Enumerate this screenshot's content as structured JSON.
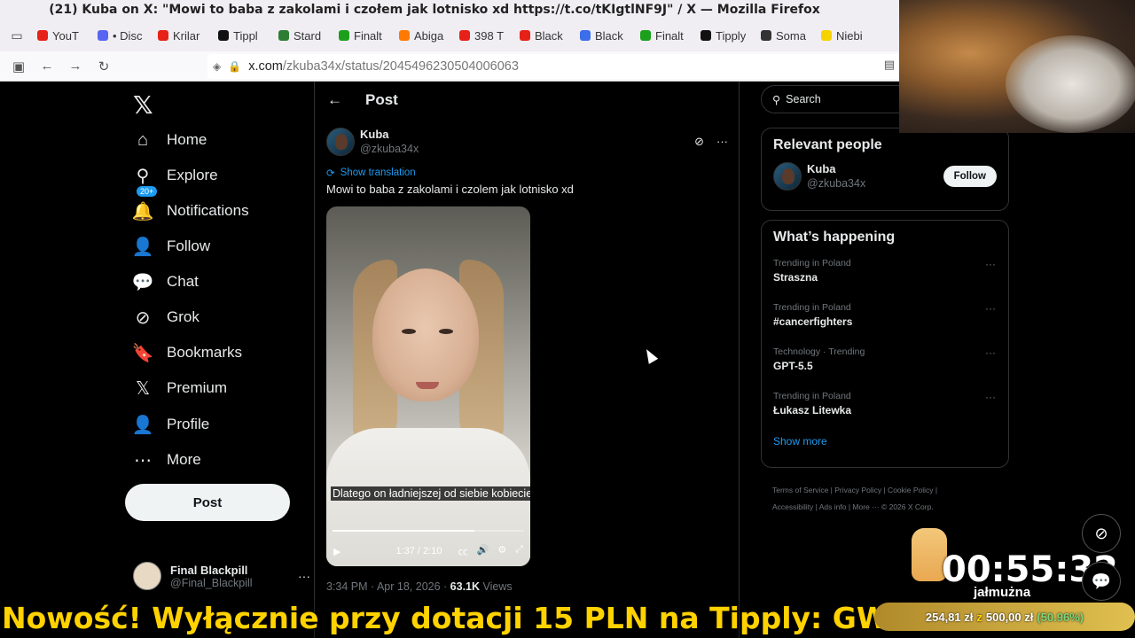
{
  "window": {
    "title": "(21) Kuba on X: \"Mowi to baba z zakolami i czołem jak lotnisko xd https://t.co/tKIgtlNF9J\" / X — Mozilla Firefox"
  },
  "tabs": [
    {
      "label": "YouT",
      "color": "#e62117"
    },
    {
      "label": "• Disc",
      "color": "#5865f2"
    },
    {
      "label": "Krilar",
      "color": "#e62117"
    },
    {
      "label": "Tippl",
      "color": "#111111"
    },
    {
      "label": "Stard",
      "color": "#2e7d32"
    },
    {
      "label": "Finalt",
      "color": "#1ca01c"
    },
    {
      "label": "Abiga",
      "color": "#ff7a00"
    },
    {
      "label": "398 T",
      "color": "#e62117"
    },
    {
      "label": "Black",
      "color": "#e62117"
    },
    {
      "label": "Black",
      "color": "#3b6ee8"
    },
    {
      "label": "Finalt",
      "color": "#1ca01c"
    },
    {
      "label": "Tipply",
      "color": "#111111"
    },
    {
      "label": "Soma",
      "color": "#333333"
    },
    {
      "label": "Niebi",
      "color": "#f5d200"
    }
  ],
  "url": {
    "host": "x.com",
    "path": "/zkuba34x/status/2045496230504006063"
  },
  "nav": {
    "items": [
      {
        "label": "Home",
        "icon": "⌂"
      },
      {
        "label": "Explore",
        "icon": "⚲"
      },
      {
        "label": "Notifications",
        "icon": "🔔"
      },
      {
        "label": "Follow",
        "icon": "👤"
      },
      {
        "label": "Chat",
        "icon": "💬"
      },
      {
        "label": "Grok",
        "icon": "⊘"
      },
      {
        "label": "Bookmarks",
        "icon": "🔖"
      },
      {
        "label": "Premium",
        "icon": "𝕏"
      },
      {
        "label": "Profile",
        "icon": "👤"
      },
      {
        "label": "More",
        "icon": "⋯"
      }
    ],
    "notifications_badge": "20+",
    "post_button": "Post",
    "account": {
      "name": "Final Blackpill",
      "handle": "@Final_Blackpill"
    }
  },
  "main": {
    "header_title": "Post",
    "tweet": {
      "name": "Kuba",
      "handle": "@zkuba34x",
      "show_translation": "Show translation",
      "text": "Mowi to baba z zakolami i czolem jak lotnisko xd",
      "video": {
        "caption": "Dlatego on ładniejszej od siebie kobiecie",
        "time": "1:37 / 2:10",
        "progress": 0.74
      },
      "timestamp": "3:34 PM · Apr 18, 2026 · ",
      "views_count": "63.1K",
      "views_label": " Views"
    }
  },
  "sidebar": {
    "search_placeholder": "Search",
    "relevant_title": "Relevant people",
    "relevant": {
      "name": "Kuba",
      "handle": "@zkuba34x",
      "follow_label": "Follow"
    },
    "happening_title": "What’s happening",
    "trends": [
      {
        "context": "Trending in Poland",
        "name": "Straszna"
      },
      {
        "context": "Trending in Poland",
        "name": "#cancerfighters"
      },
      {
        "context": "Technology · Trending",
        "name": "GPT-5.5"
      },
      {
        "context": "Trending in Poland",
        "name": "Łukasz Litewka"
      }
    ],
    "show_more": "Show more",
    "footer_line1": "Terms of Service  |  Privacy Policy  |  Cookie Policy  |",
    "footer_line2": "Accessibility  |  Ads info  |  More ···  © 2026 X Corp."
  },
  "overlay": {
    "ticker": "Nowość! Wyłącznie przy dotacji 15 PLN na Tipply: GWAŁTY!",
    "goal_current": "254,81 zł",
    "goal_of": "z",
    "goal_target": "500,00 zł",
    "goal_percent": "(50.96%)",
    "timer": "00:55:32",
    "timer_label": "jałmużna"
  }
}
